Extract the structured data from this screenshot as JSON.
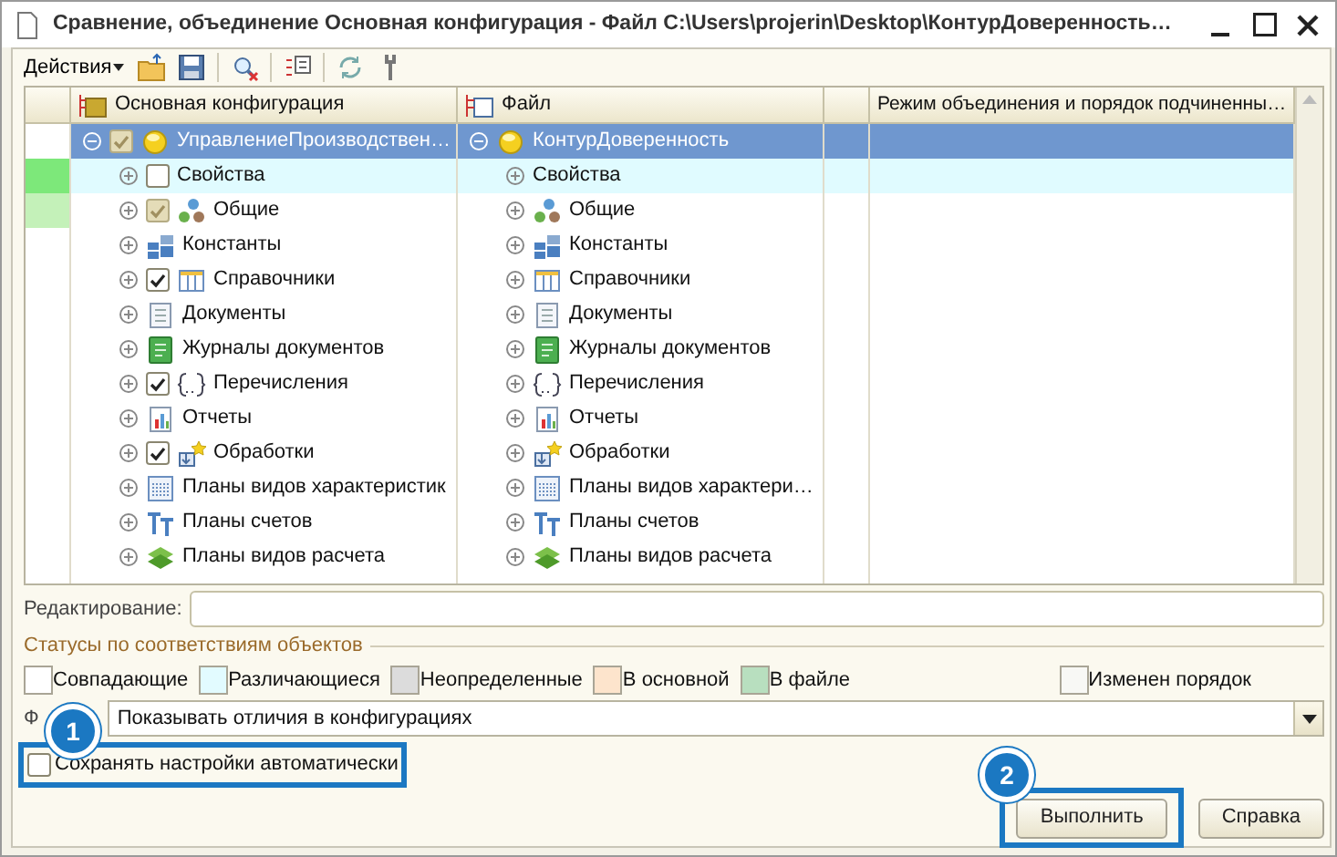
{
  "window": {
    "title": "Сравнение, объединение Основная конфигурация - Файл C:\\Users\\projerin\\Desktop\\КонтурДоверенность…"
  },
  "toolbar": {
    "menu": "Действия"
  },
  "tree": {
    "columns": [
      "Основная конфигурация",
      "Файл",
      "Режим объединения и порядок подчиненны…"
    ],
    "rows": [
      {
        "expanded": true,
        "selected": true,
        "differs": false,
        "main": {
          "text": "УправлениеПроизводствен…",
          "kind": "root",
          "checkbox": {
            "checked": true,
            "disabled": true
          }
        },
        "file": {
          "text": "КонтурДоверенность",
          "kind": "root"
        },
        "children": [
          {
            "expanded": false,
            "selected": false,
            "differs": true,
            "color": "#7de87a",
            "main": {
              "text": "Свойства",
              "kind": "none",
              "checkbox": {
                "checked": false,
                "disabled": false
              }
            },
            "file": {
              "text": "Свойства",
              "kind": "none"
            }
          },
          {
            "expanded": false,
            "selected": false,
            "differs": false,
            "color": "#c4f1b9",
            "main": {
              "text": "Общие",
              "kind": "common",
              "checkbox": {
                "checked": true,
                "disabled": true
              }
            },
            "file": {
              "text": "Общие",
              "kind": "common"
            }
          },
          {
            "expanded": false,
            "selected": false,
            "differs": false,
            "main": {
              "text": "Константы",
              "kind": "constants"
            },
            "file": {
              "text": "Константы",
              "kind": "constants"
            }
          },
          {
            "expanded": false,
            "selected": false,
            "differs": false,
            "main": {
              "text": "Справочники",
              "kind": "catalogs",
              "checkbox": {
                "checked": true,
                "disabled": false
              }
            },
            "file": {
              "text": "Справочники",
              "kind": "catalogs"
            }
          },
          {
            "expanded": false,
            "selected": false,
            "differs": false,
            "main": {
              "text": "Документы",
              "kind": "documents"
            },
            "file": {
              "text": "Документы",
              "kind": "documents"
            }
          },
          {
            "expanded": false,
            "selected": false,
            "differs": false,
            "main": {
              "text": "Журналы документов",
              "kind": "journals"
            },
            "file": {
              "text": "Журналы документов",
              "kind": "journals"
            }
          },
          {
            "expanded": false,
            "selected": false,
            "differs": false,
            "main": {
              "text": "Перечисления",
              "kind": "enums",
              "checkbox": {
                "checked": true,
                "disabled": false
              }
            },
            "file": {
              "text": "Перечисления",
              "kind": "enums"
            }
          },
          {
            "expanded": false,
            "selected": false,
            "differs": false,
            "main": {
              "text": "Отчеты",
              "kind": "reports"
            },
            "file": {
              "text": "Отчеты",
              "kind": "reports"
            }
          },
          {
            "expanded": false,
            "selected": false,
            "differs": false,
            "main": {
              "text": "Обработки",
              "kind": "processing",
              "checkbox": {
                "checked": true,
                "disabled": false
              }
            },
            "file": {
              "text": "Обработки",
              "kind": "processing"
            }
          },
          {
            "expanded": false,
            "selected": false,
            "differs": false,
            "main": {
              "text": "Планы видов характеристик",
              "kind": "chartypes"
            },
            "file": {
              "text": "Планы видов характери…",
              "kind": "chartypes"
            }
          },
          {
            "expanded": false,
            "selected": false,
            "differs": false,
            "main": {
              "text": "Планы счетов",
              "kind": "accounts"
            },
            "file": {
              "text": "Планы счетов",
              "kind": "accounts"
            }
          },
          {
            "expanded": false,
            "selected": false,
            "differs": false,
            "main": {
              "text": "Планы видов расчета",
              "kind": "calc"
            },
            "file": {
              "text": "Планы видов расчета",
              "kind": "calc"
            }
          }
        ]
      }
    ]
  },
  "editing": {
    "label": "Редактирование:"
  },
  "statuses": {
    "title": "Статусы по соответствиям объектов",
    "items": [
      {
        "label": "Совпадающие",
        "color": "#ffffff"
      },
      {
        "label": "Различающиеся",
        "color": "#e2fbff"
      },
      {
        "label": "Неопределенные",
        "color": "#dcdcdc"
      },
      {
        "label": "В основной",
        "color": "#fde4cc"
      },
      {
        "label": "В файле",
        "color": "#b8dfbf"
      },
      {
        "label": "Изменен порядок",
        "color": "#f8f8f5"
      }
    ]
  },
  "filter": {
    "label": "Ф",
    "value": "Показывать отличия в конфигурациях"
  },
  "autosave": {
    "label": "Сохранять настройки автоматически",
    "checked": false
  },
  "buttons": [
    "Выполнить",
    "Справка"
  ],
  "annotations": [
    {
      "number": "1"
    },
    {
      "number": "2"
    }
  ]
}
